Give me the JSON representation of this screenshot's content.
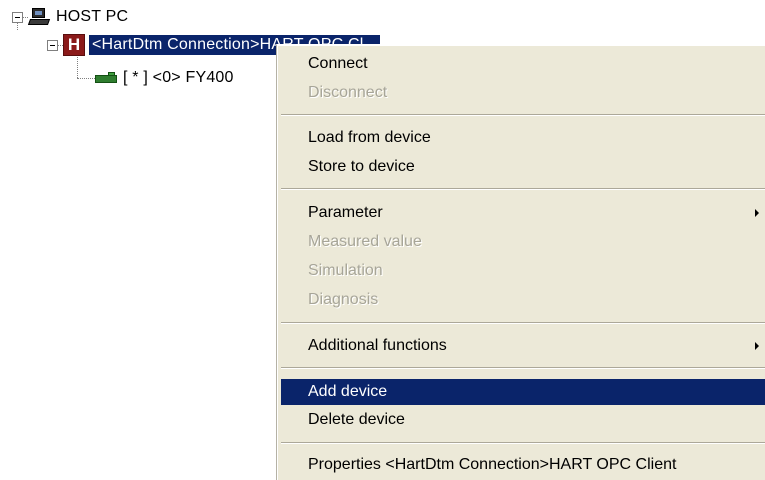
{
  "tree": {
    "root": {
      "label": "HOST PC",
      "icon": "computer-icon"
    },
    "connection": {
      "label": "<HartDtm Connection>HART OPC Cl...",
      "icon": "hart-h-icon",
      "icon_letter": "H"
    },
    "device": {
      "label": "[ * ] <0> FY400",
      "icon": "device-icon"
    }
  },
  "context_menu": {
    "groups": [
      [
        {
          "label": "Connect",
          "enabled": true
        },
        {
          "label": "Disconnect",
          "enabled": false
        }
      ],
      [
        {
          "label": "Load from device",
          "enabled": true
        },
        {
          "label": "Store to device",
          "enabled": true
        }
      ],
      [
        {
          "label": "Parameter",
          "enabled": true,
          "submenu": true
        },
        {
          "label": "Measured value",
          "enabled": false
        },
        {
          "label": "Simulation",
          "enabled": false
        },
        {
          "label": "Diagnosis",
          "enabled": false
        }
      ],
      [
        {
          "label": "Additional functions",
          "enabled": true,
          "submenu": true
        }
      ],
      [
        {
          "label": "Add device",
          "enabled": true,
          "highlighted": true
        },
        {
          "label": "Delete device",
          "enabled": true
        }
      ],
      [
        {
          "label": "Properties <HartDtm Connection>HART OPC Client",
          "enabled": true
        }
      ]
    ]
  },
  "colors": {
    "selection": "#0a246a",
    "menu_background": "#ece9d8",
    "disabled_text": "#a7a598",
    "hart_icon": "#8b1a1a",
    "device_icon": "#2f7d2f"
  }
}
